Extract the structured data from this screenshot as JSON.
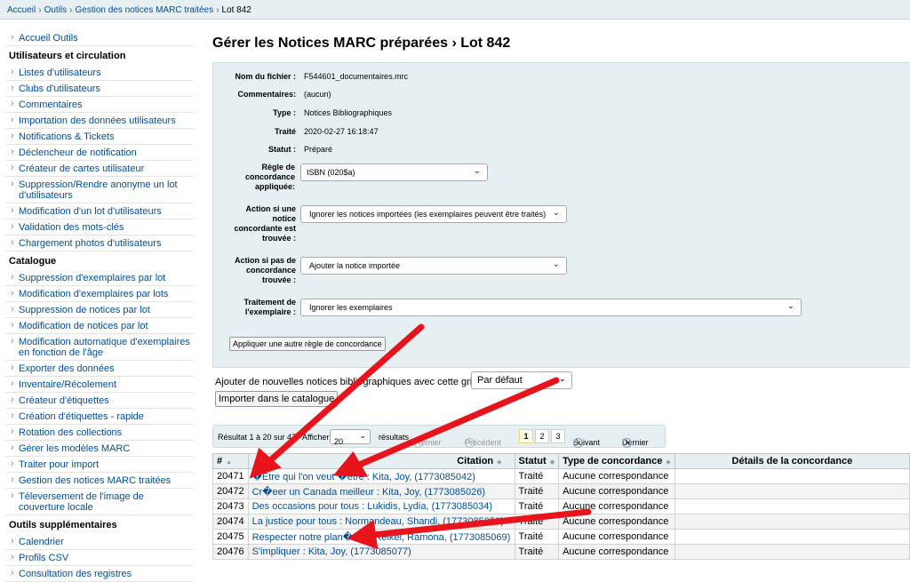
{
  "breadcrumb": [
    "Accueil",
    "Outils",
    "Gestion des notices MARC traitées",
    "Lot 842"
  ],
  "sidebar": {
    "top_item": "Accueil Outils",
    "sections": [
      {
        "title": "Utilisateurs et circulation",
        "items": [
          "Listes d'utilisateurs",
          "Clubs d'utilisateurs",
          "Commentaires",
          "Importation des données utilisateurs",
          "Notifications & Tickets",
          "Déclencheur de notification",
          "Créateur de cartes utilisateur",
          "Suppression/Rendre anonyme un lot d'utilisateurs",
          "Modification d'un lot d'utilisateurs",
          "Validation des mots-clés",
          "Chargement photos d'utilisateurs"
        ]
      },
      {
        "title": "Catalogue",
        "items": [
          "Suppression d'exemplaires par lot",
          "Modification d'exemplaires par lots",
          "Suppression de notices par lot",
          "Modification de notices par lot",
          "Modification automatique d'exemplaires en fonction de l'âge",
          "Exporter des données",
          "Inventaire/Récolement",
          "Créateur d'étiquettes",
          "Création d'étiquettes - rapide",
          "Rotation des collections",
          "Gérer les modèles MARC",
          "Traiter pour import",
          "Gestion des notices MARC traitées",
          "Téleversement de l'image de couverture locale"
        ]
      },
      {
        "title": "Outils supplémentaires",
        "items": [
          "Calendrier",
          "Profils CSV",
          "Consultation des registres"
        ]
      }
    ]
  },
  "page_title": "Gérer les Notices MARC préparées › Lot 842",
  "details": {
    "file_label": "Nom du fichier :",
    "file_value": "F544601_documentaires.mrc",
    "comments_label": "Commentaires:",
    "comments_value": "(aucun)",
    "type_label": "Type :",
    "type_value": "Notices Bibliographiques",
    "processed_label": "Traité",
    "processed_value": "2020-02-27 16:18:47",
    "status_label": "Statut :",
    "status_value": "Préparé",
    "rule_label": "Règle de concordance appliquée:",
    "rule_value": "ISBN (020$a)",
    "action_match_label": "Action si une notice concordante est trouvée :",
    "action_match_value": "Ignorer les notices importées (les exemplaires peuvent être traités)",
    "action_nomatch_label": "Action si pas de concordance trouvée :",
    "action_nomatch_value": "Ajouter la notice importée",
    "item_label": "Traitement de l'exemplaire :",
    "item_value": "Ignorer les exemplaires",
    "apply_button": "Appliquer une autre règle de concordance"
  },
  "framework": {
    "label": "Ajouter de nouvelles notices bibliographiques avec cette grille :",
    "value": "Par défaut"
  },
  "import_button": "Importer dans le catalogue",
  "pager": {
    "summary": "Résultat 1 à 20 sur 47",
    "show_label": "Afficher",
    "per_page": "20",
    "results_label": "résultats",
    "first": "Premier",
    "prev": "Précédent",
    "pages": [
      "1",
      "2",
      "3"
    ],
    "next": "Suivant",
    "last": "Dernier"
  },
  "table": {
    "headers": [
      "#",
      "Citation",
      "Statut",
      "Type de concordance",
      "Détails de la concordance"
    ],
    "rows": [
      {
        "id": "20471",
        "citation": "�Etre qui l'on veut �etre : Kita, Joy, (1773085042)",
        "status": "Traité",
        "match": "Aucune correspondance"
      },
      {
        "id": "20472",
        "citation": "Cr�eer un Canada meilleur : Kita, Joy, (1773085026)",
        "status": "Traité",
        "match": "Aucune correspondance"
      },
      {
        "id": "20473",
        "citation": "Des occasions pour tous : Lukidis, Lydia, (1773085034)",
        "status": "Traité",
        "match": "Aucune correspondance"
      },
      {
        "id": "20474",
        "citation": "La justice pour tous : Normandeau, Shandi, (1773085050)",
        "status": "Traité",
        "match": "Aucune correspondance"
      },
      {
        "id": "20475",
        "citation": "Respecter notre plan�ete : Reikel, Ramona, (1773085069)",
        "status": "Traité",
        "match": "Aucune correspondance"
      },
      {
        "id": "20476",
        "citation": "S'impliquer : Kita, Joy, (1773085077)",
        "status": "Traité",
        "match": "Aucune correspondance"
      }
    ]
  },
  "colors": {
    "annotation": "#e8141c",
    "link": "#004d99",
    "panel": "#e6f0f2"
  }
}
